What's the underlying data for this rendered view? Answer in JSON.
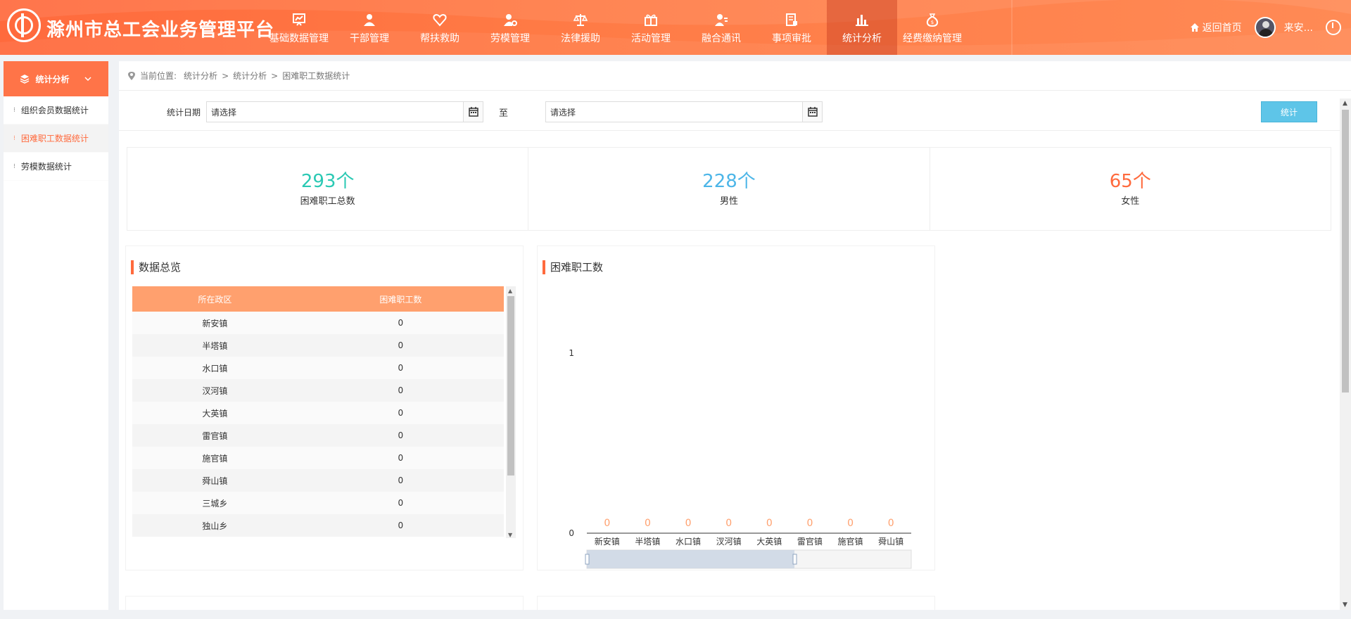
{
  "header": {
    "title": "滁州市总工会业务管理平台",
    "nav": [
      {
        "label": "基础数据管理",
        "icon": "chart-board-icon"
      },
      {
        "label": "干部管理",
        "icon": "user-icon"
      },
      {
        "label": "帮扶救助",
        "icon": "heart-icon"
      },
      {
        "label": "劳模管理",
        "icon": "user-settings-icon"
      },
      {
        "label": "法律援助",
        "icon": "scale-icon"
      },
      {
        "label": "活动管理",
        "icon": "gift-icon"
      },
      {
        "label": "融合通讯",
        "icon": "user-list-icon"
      },
      {
        "label": "事项审批",
        "icon": "document-check-icon"
      },
      {
        "label": "统计分析",
        "icon": "bar-chart-icon",
        "active": true
      },
      {
        "label": "经费缴纳管理",
        "icon": "money-bag-icon"
      }
    ],
    "home_label": "返回首页",
    "username": "来安..."
  },
  "sidebar": {
    "title": "统计分析",
    "items": [
      {
        "label": "组织会员数据统计"
      },
      {
        "label": "困难职工数据统计",
        "active": true
      },
      {
        "label": "劳模数据统计"
      }
    ]
  },
  "breadcrumb": {
    "prefix": "当前位置:",
    "items": [
      "统计分析",
      "统计分析",
      "困难职工数据统计"
    ],
    "separator": ">"
  },
  "filter": {
    "label": "统计日期",
    "start_placeholder": "请选择",
    "to_label": "至",
    "end_placeholder": "请选择",
    "submit_label": "统计"
  },
  "summary": [
    {
      "value": "293个",
      "label": "困难职工总数",
      "color": "#2bc9b4"
    },
    {
      "value": "228个",
      "label": "男性",
      "color": "#4db6e8"
    },
    {
      "value": "65个",
      "label": "女性",
      "color": "#ff6a3d"
    }
  ],
  "overview": {
    "title": "数据总览",
    "columns": [
      "所在政区",
      "困难职工数"
    ],
    "rows": [
      [
        "新安镇",
        "0"
      ],
      [
        "半塔镇",
        "0"
      ],
      [
        "水口镇",
        "0"
      ],
      [
        "汊河镇",
        "0"
      ],
      [
        "大英镇",
        "0"
      ],
      [
        "雷官镇",
        "0"
      ],
      [
        "施官镇",
        "0"
      ],
      [
        "舜山镇",
        "0"
      ],
      [
        "三城乡",
        "0"
      ],
      [
        "独山乡",
        "0"
      ]
    ]
  },
  "chart_title": "困难职工数",
  "chart_data": {
    "type": "bar",
    "categories": [
      "新安镇",
      "半塔镇",
      "水口镇",
      "汊河镇",
      "大英镇",
      "雷官镇",
      "施官镇",
      "舜山镇"
    ],
    "values": [
      0,
      0,
      0,
      0,
      0,
      0,
      0,
      0
    ],
    "y_ticks": [
      "0",
      "1"
    ],
    "ylim": [
      0,
      1
    ],
    "label_color": "#ffa06e",
    "datazoom": {
      "start": 0,
      "end": 0.64
    }
  },
  "colors": {
    "accent": "#ff6a3d",
    "button": "#5ec5e8",
    "table_header": "#ffa06e"
  }
}
